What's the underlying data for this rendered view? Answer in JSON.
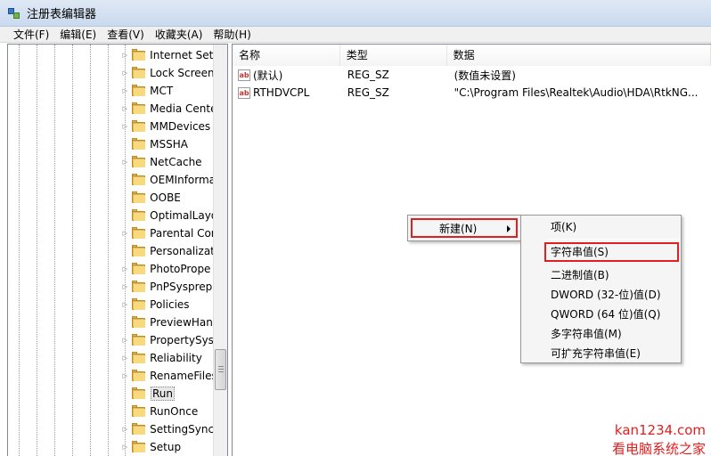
{
  "window": {
    "title": "注册表编辑器"
  },
  "menubar": {
    "items": [
      "文件(F)",
      "编辑(E)",
      "查看(V)",
      "收藏夹(A)",
      "帮助(H)"
    ]
  },
  "tree": {
    "items": [
      {
        "label": "Internet Sett",
        "expandable": true
      },
      {
        "label": "Lock Screen",
        "expandable": true
      },
      {
        "label": "MCT",
        "expandable": true
      },
      {
        "label": "Media Cente",
        "expandable": true
      },
      {
        "label": "MMDevices",
        "expandable": true
      },
      {
        "label": "MSSHA",
        "expandable": false
      },
      {
        "label": "NetCache",
        "expandable": true
      },
      {
        "label": "OEMInforma",
        "expandable": false
      },
      {
        "label": "OOBE",
        "expandable": false
      },
      {
        "label": "OptimalLayo",
        "expandable": false
      },
      {
        "label": "Parental Cor",
        "expandable": true
      },
      {
        "label": "Personalizat",
        "expandable": false
      },
      {
        "label": "PhotoPrope",
        "expandable": true
      },
      {
        "label": "PnPSysprep",
        "expandable": true
      },
      {
        "label": "Policies",
        "expandable": true
      },
      {
        "label": "PreviewHan",
        "expandable": false
      },
      {
        "label": "PropertySys",
        "expandable": true
      },
      {
        "label": "Reliability",
        "expandable": true
      },
      {
        "label": "RenameFiles",
        "expandable": true
      },
      {
        "label": "Run",
        "expandable": false,
        "selected": true
      },
      {
        "label": "RunOnce",
        "expandable": false
      },
      {
        "label": "SettingSync",
        "expandable": true
      },
      {
        "label": "Setup",
        "expandable": true
      }
    ]
  },
  "list": {
    "columns": [
      "名称",
      "类型",
      "数据"
    ],
    "rows": [
      {
        "name": "(默认)",
        "type": "REG_SZ",
        "data": "(数值未设置)"
      },
      {
        "name": "RTHDVCPL",
        "type": "REG_SZ",
        "data": "\"C:\\Program Files\\Realtek\\Audio\\HDA\\RtkNG..."
      }
    ],
    "value_icon_text": "ab"
  },
  "context_menu": {
    "new_label": "新建(N)"
  },
  "submenu": {
    "items": [
      "项(K)",
      "字符串值(S)",
      "二进制值(B)",
      "DWORD (32-位)值(D)",
      "QWORD (64 位)值(Q)",
      "多字符串值(M)",
      "可扩充字符串值(E)"
    ]
  },
  "watermark": {
    "line1": "kan1234.com",
    "line2": "看电脑系统之家"
  },
  "colors": {
    "highlight_box": "#e02020",
    "titlebar": "#c9d9ee",
    "folder": "#e5b94f"
  }
}
